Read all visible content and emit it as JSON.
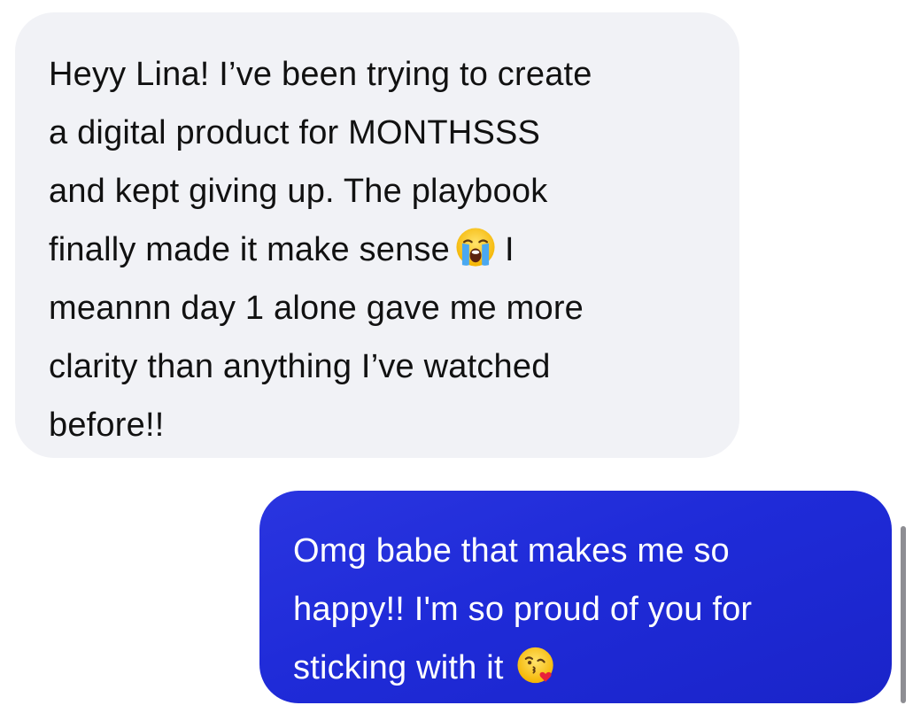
{
  "conversation": {
    "received_message": {
      "lines": [
        "Heyy Lina! I’ve been trying to create",
        "a digital product for MONTHSSS",
        "and kept giving up. The playbook",
        "finally made it make sense",
        "I",
        "meannn day 1 alone gave me more",
        "clarity than anything I’ve watched",
        "before!!"
      ],
      "emoji": "loudly-crying-face-icon"
    },
    "sent_message": {
      "lines": [
        "Omg babe that makes me so",
        "happy!! I'm so proud of you for",
        "sticking with it"
      ],
      "emoji": "face-blowing-a-kiss-icon"
    }
  },
  "colors": {
    "received_bubble": "#f1f2f6",
    "received_text": "#111111",
    "sent_bubble": "#1f2bd8",
    "sent_text": "#ffffff",
    "background": "#ffffff"
  }
}
